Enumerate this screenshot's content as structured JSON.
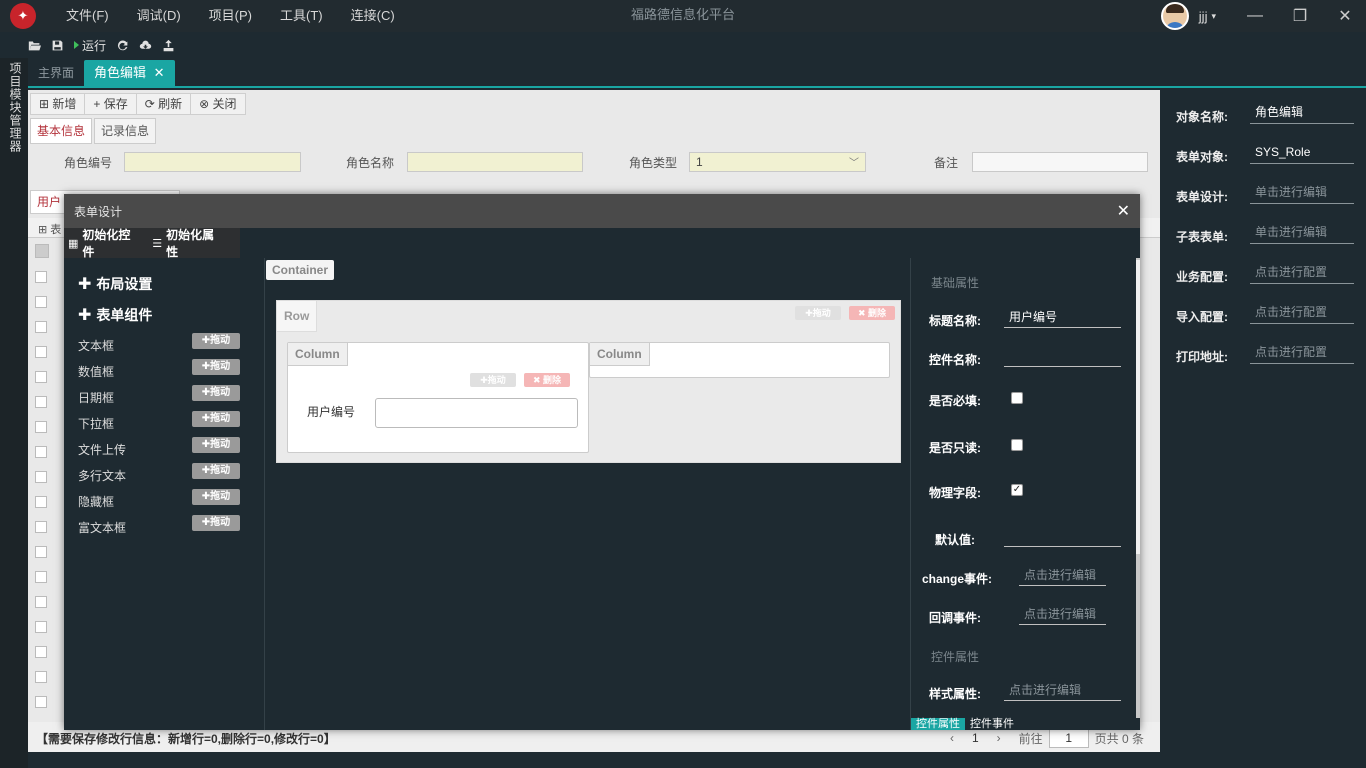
{
  "titlebar": {
    "logo_glyph": "✦",
    "menu": [
      "文件(F)",
      "调试(D)",
      "项目(P)",
      "工具(T)",
      "连接(C)"
    ],
    "app_title": "福路德信息化平台",
    "user_name": "jjj",
    "user_caret": "▾",
    "minimize": "—",
    "restore": "❐",
    "close": "✕"
  },
  "toolbar": {
    "run_label": "运行"
  },
  "side": {
    "label": "项目模块管理器"
  },
  "tabs": {
    "home": "主界面",
    "role_edit": "角色编辑",
    "close_glyph": "✕"
  },
  "page": {
    "buttons": [
      "⊞ 新增",
      "+ 保存",
      "⟳ 刷新",
      "⊗ 关闭"
    ],
    "subtabs": [
      "基本信息",
      "记录信息"
    ],
    "fields": {
      "role_code": "角色编号",
      "role_name": "角色名称",
      "role_type": "角色类型",
      "role_type_value": "1",
      "remark": "备注"
    },
    "subtab2": "用户",
    "grid_head_icon": "⊞ 表",
    "status": "【需要保存修改行信息：新增行=0,删除行=0,修改行=0】",
    "pager": {
      "prev": "‹",
      "first": "1",
      "next": "›",
      "goto": "前往",
      "page": "1",
      "total": "页共 0 条"
    }
  },
  "props": [
    {
      "label": "对象名称:",
      "value": "角色编辑",
      "placeholder": false
    },
    {
      "label": "表单对象:",
      "value": "SYS_Role",
      "placeholder": false
    },
    {
      "label": "表单设计:",
      "value": "单击进行编辑",
      "placeholder": true
    },
    {
      "label": "子表表单:",
      "value": "单击进行编辑",
      "placeholder": true
    },
    {
      "label": "业务配置:",
      "value": "点击进行配置",
      "placeholder": true
    },
    {
      "label": "导入配置:",
      "value": "点击进行配置",
      "placeholder": true
    },
    {
      "label": "打印地址:",
      "value": "点击进行配置",
      "placeholder": true
    }
  ],
  "modal": {
    "title": "表单设计",
    "close": "✕",
    "tabs": [
      "初始化控件",
      "初始化属性"
    ],
    "tab_icons": [
      "▦",
      "☰"
    ],
    "layout_heading": "布局设置",
    "components_heading": "表单组件",
    "components": [
      "文本框",
      "数值框",
      "日期框",
      "下拉框",
      "文件上传",
      "多行文本",
      "隐藏框",
      "富文本框"
    ],
    "drag_label": "✚拖动",
    "delete_label": "✖ 删除",
    "canvas": {
      "container": "Container",
      "row": "Row",
      "column": "Column",
      "field_label": "用户编号"
    },
    "attrs": {
      "basic_title": "基础属性",
      "title_name": "标题名称:",
      "title_name_value": "用户编号",
      "control_name": "控件名称:",
      "required": "是否必填:",
      "readonly": "是否只读:",
      "physical": "物理字段:",
      "physical_check": "✓",
      "default": "默认值:",
      "change_event": "change事件:",
      "callback_event": "回调事件:",
      "edit_placeholder": "点击进行编辑",
      "control_title": "控件属性",
      "style": "样式属性:",
      "bottom_tabs": [
        "控件属性",
        "控件事件"
      ]
    }
  }
}
